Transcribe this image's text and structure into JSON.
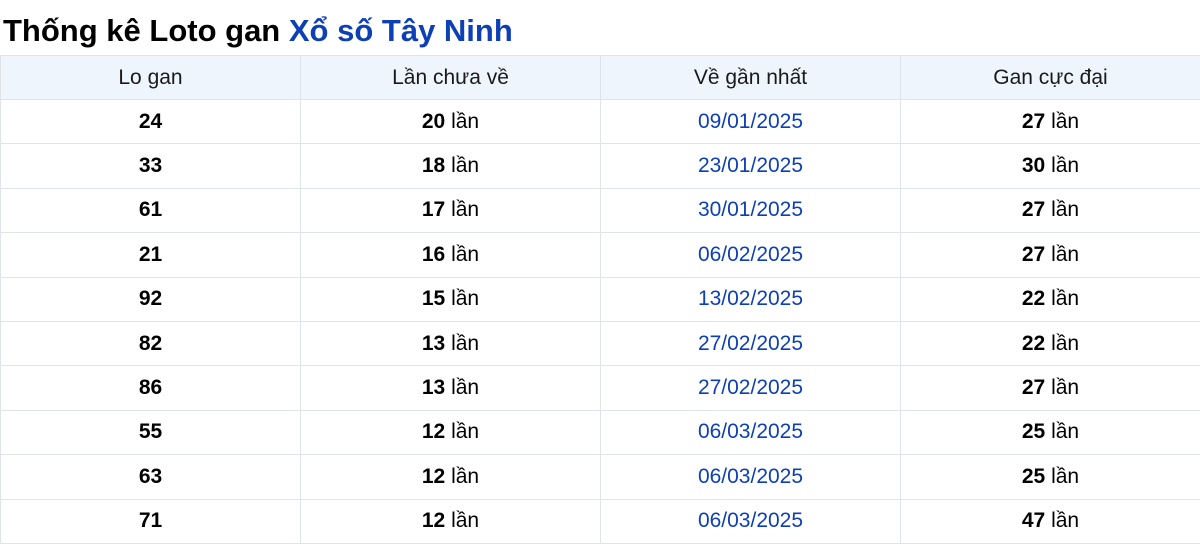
{
  "page": {
    "title_prefix": "Thống kê Loto gan",
    "title_highlight": "Xổ số Tây Ninh"
  },
  "colors": {
    "accent": "#0d3fb5",
    "header_bg": "#eef5fd",
    "border": "#dfe3ea"
  },
  "table": {
    "headers": [
      "Lo gan",
      "Lần chưa về",
      "Về gần nhất",
      "Gan cực đại"
    ],
    "unit": "lần",
    "rows": [
      {
        "lo": "24",
        "missed": "20",
        "last": "09/01/2025",
        "max": "27"
      },
      {
        "lo": "33",
        "missed": "18",
        "last": "23/01/2025",
        "max": "30"
      },
      {
        "lo": "61",
        "missed": "17",
        "last": "30/01/2025",
        "max": "27"
      },
      {
        "lo": "21",
        "missed": "16",
        "last": "06/02/2025",
        "max": "27"
      },
      {
        "lo": "92",
        "missed": "15",
        "last": "13/02/2025",
        "max": "22"
      },
      {
        "lo": "82",
        "missed": "13",
        "last": "27/02/2025",
        "max": "22"
      },
      {
        "lo": "86",
        "missed": "13",
        "last": "27/02/2025",
        "max": "27"
      },
      {
        "lo": "55",
        "missed": "12",
        "last": "06/03/2025",
        "max": "25"
      },
      {
        "lo": "63",
        "missed": "12",
        "last": "06/03/2025",
        "max": "25"
      },
      {
        "lo": "71",
        "missed": "12",
        "last": "06/03/2025",
        "max": "47"
      }
    ]
  }
}
